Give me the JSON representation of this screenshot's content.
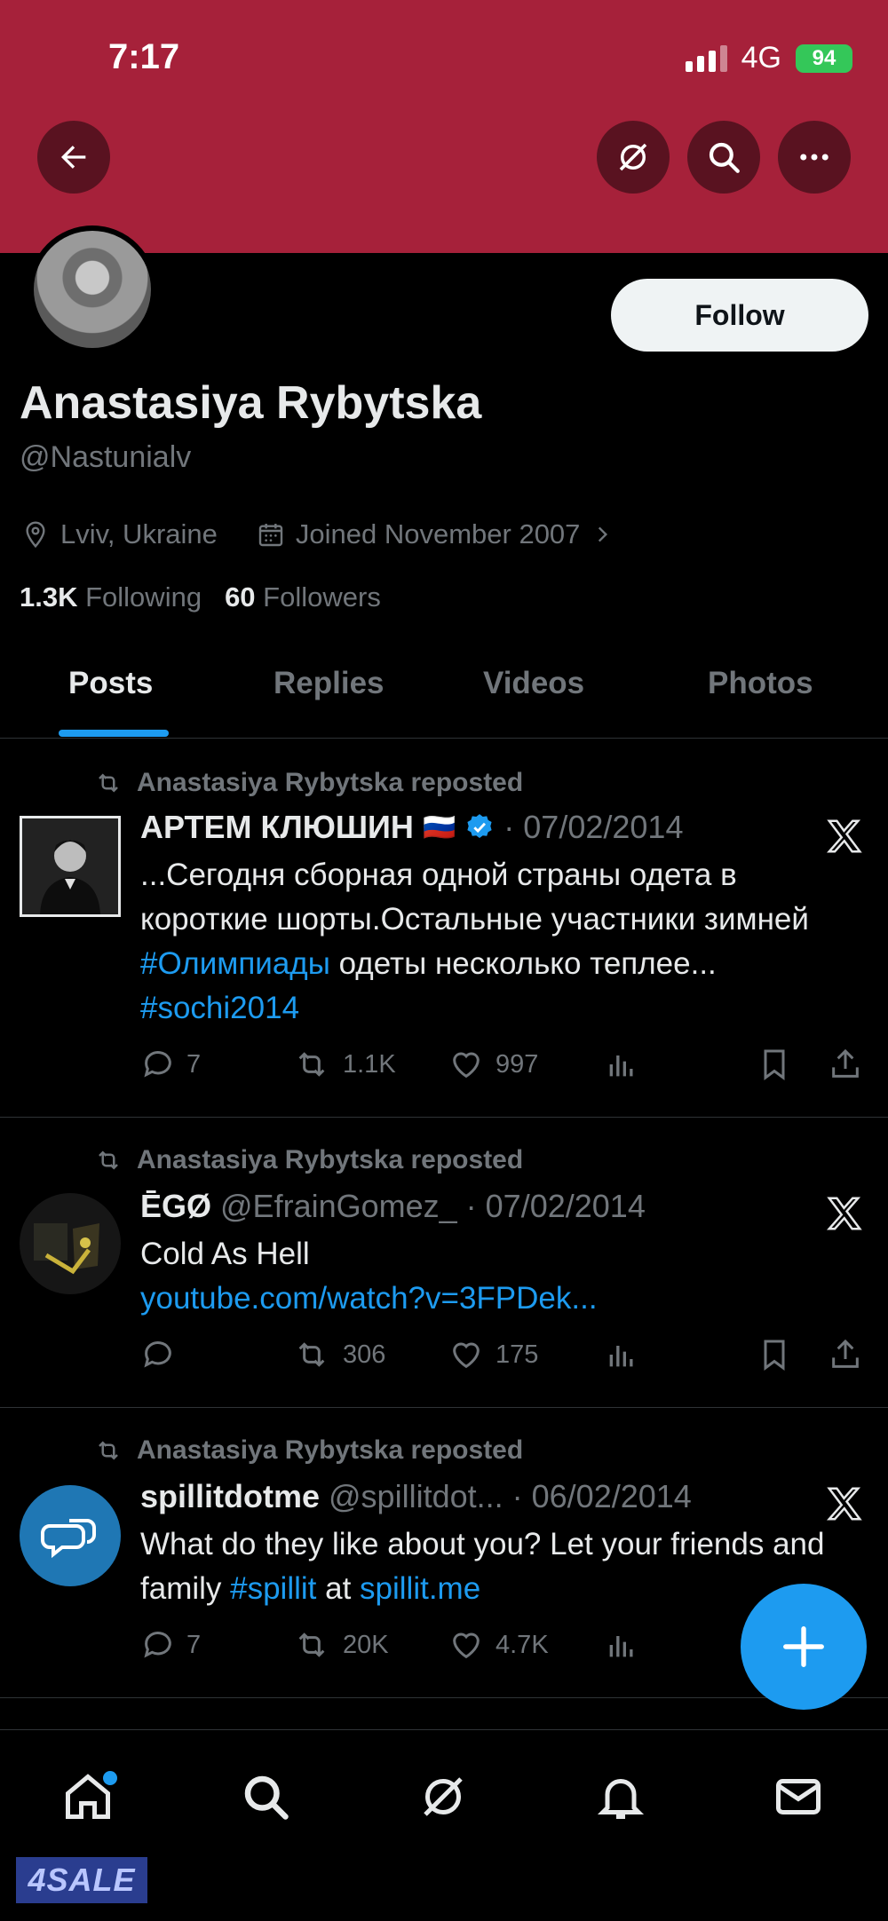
{
  "status_bar": {
    "time": "7:17",
    "network": "4G",
    "battery": "94"
  },
  "colors": {
    "banner": "#a6213a",
    "accent": "#1d9bf0",
    "muted": "#71767b",
    "text": "#e7e9ea"
  },
  "header": {
    "back_icon": "arrow-left-icon",
    "grok_icon": "grok-icon",
    "search_icon": "search-icon",
    "more_icon": "more-icon"
  },
  "profile": {
    "name": "Anastasiya Rybytska",
    "handle": "@Nastunialv",
    "follow_label": "Follow",
    "location": "Lviv, Ukraine",
    "joined": "Joined November 2007",
    "following_count": "1.3K",
    "following_label": "Following",
    "followers_count": "60",
    "followers_label": "Followers"
  },
  "tabs": [
    {
      "label": "Posts",
      "active": true
    },
    {
      "label": "Replies",
      "active": false
    },
    {
      "label": "Videos",
      "active": false
    },
    {
      "label": "Photos",
      "active": false
    }
  ],
  "posts": [
    {
      "repost_label": "Anastasiya Rybytska reposted",
      "author": "АРТЕМ КЛЮШИН",
      "flag": "🇷🇺",
      "verified": true,
      "handle": "",
      "date": "· 07/02/2014",
      "text_1": "...Сегодня сборная одной страны одета  в короткие шорты.Остальные участники зимней ",
      "hashtag_1": "#Олимпиады",
      "text_2": " одеты несколько теплее... ",
      "hashtag_2": "#sochi2014",
      "replies": "7",
      "reposts": "1.1K",
      "likes": "997"
    },
    {
      "repost_label": "Anastasiya Rybytska reposted",
      "author": "ĒGØ",
      "handle": "@EfrainGomez_",
      "date": "· 07/02/2014",
      "text_1": "Cold As Hell",
      "link": "youtube.com/watch?v=3FPDek...",
      "replies": "",
      "reposts": "306",
      "likes": "175"
    },
    {
      "repost_label": "Anastasiya Rybytska reposted",
      "author": "spillitdotme",
      "handle": "@spillitdot...",
      "date": "· 06/02/2014",
      "text_1": "What do they like about you? Let your friends and family ",
      "hashtag_1": "#spillit",
      "text_2": " at ",
      "link": "spillit.me",
      "replies": "7",
      "reposts": "20K",
      "likes": "4.7K"
    }
  ],
  "fab_icon": "compose-plus-icon",
  "bottom_nav": [
    "home-icon",
    "search-icon",
    "grok-icon",
    "notifications-icon",
    "messages-icon"
  ],
  "watermark": "4SALE"
}
